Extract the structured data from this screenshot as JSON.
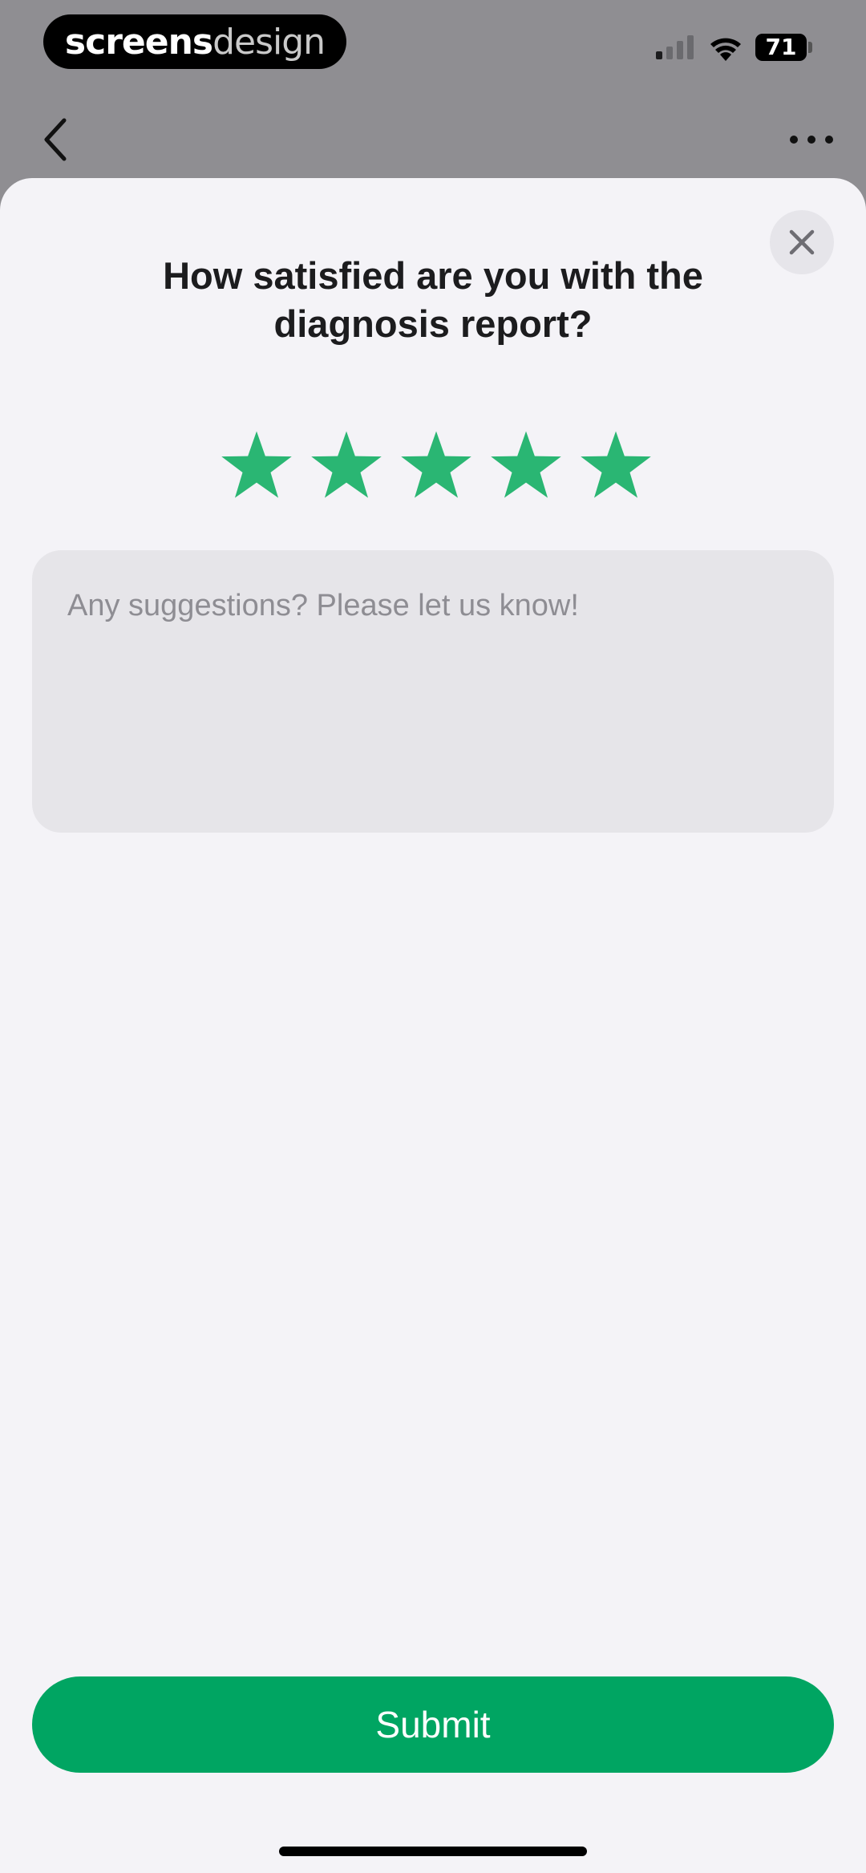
{
  "status_bar": {
    "brand_bold": "screens",
    "brand_light": "design",
    "battery": "71",
    "icons": [
      "signal-icon",
      "wifi-icon",
      "battery-icon"
    ]
  },
  "nav": {
    "icons": [
      "back-icon",
      "more-icon"
    ]
  },
  "sheet": {
    "title": "How satisfied are you with the diagnosis report?",
    "rating": 5,
    "rating_max": 5,
    "suggestion_placeholder": "Any suggestions? Please let us know!",
    "suggestion_value": "",
    "submit_label": "Submit",
    "close_icon": "close-icon"
  },
  "colors": {
    "accent": "#00a562",
    "star": "#2ab673",
    "sheet_bg": "#f4f3f7",
    "backdrop": "#8f8e92"
  }
}
